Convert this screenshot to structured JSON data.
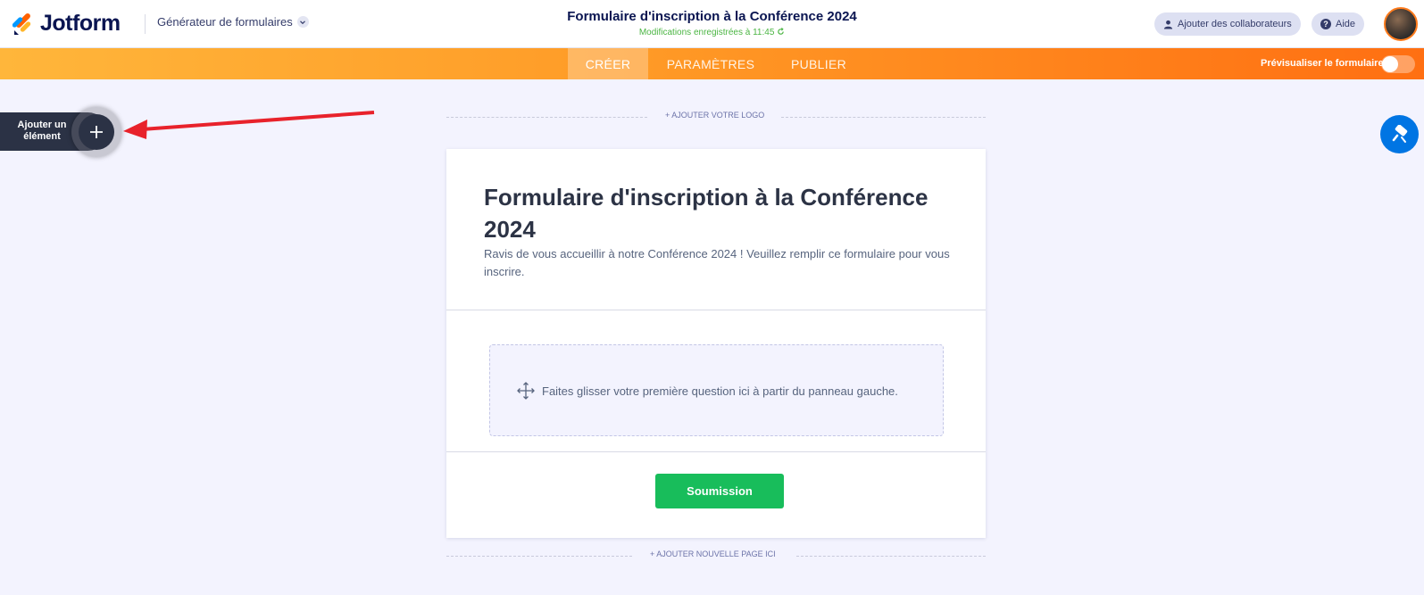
{
  "header": {
    "logo_text": "Jotform",
    "builder_menu_label": "Générateur de formulaires",
    "form_title": "Formulaire d'inscription à la Conférence 2024",
    "save_status": "Modifications enregistrées à 11:45",
    "collaborators_label": "Ajouter des collaborateurs",
    "help_label": "Aide"
  },
  "nav": {
    "tabs": [
      {
        "label": "CRÉER",
        "active": true
      },
      {
        "label": "PARAMÈTRES",
        "active": false
      },
      {
        "label": "PUBLIER",
        "active": false
      }
    ],
    "preview_label": "Prévisualiser le formulaire",
    "preview_enabled": false
  },
  "left_panel": {
    "add_element_label": "Ajouter un élément",
    "add_icon": "plus-icon"
  },
  "canvas": {
    "add_logo_label": "+ AJOUTER VOTRE LOGO",
    "add_page_label": "+ AJOUTER NOUVELLE PAGE ICI"
  },
  "form": {
    "title": "Formulaire d'inscription à la Conférence 2024",
    "description": "Ravis de vous accueillir à notre Conférence 2024 ! Veuillez remplir ce formulaire pour vous inscrire.",
    "dropzone_text": "Faites glisser votre première question ici à partir du panneau gauche.",
    "submit_label": "Soumission"
  },
  "colors": {
    "brand_orange": "#ff6f12",
    "submit_green": "#18bd5b",
    "designer_blue": "#0075e3",
    "save_green": "#4bb543",
    "annotation_arrow": "#e8222b"
  }
}
